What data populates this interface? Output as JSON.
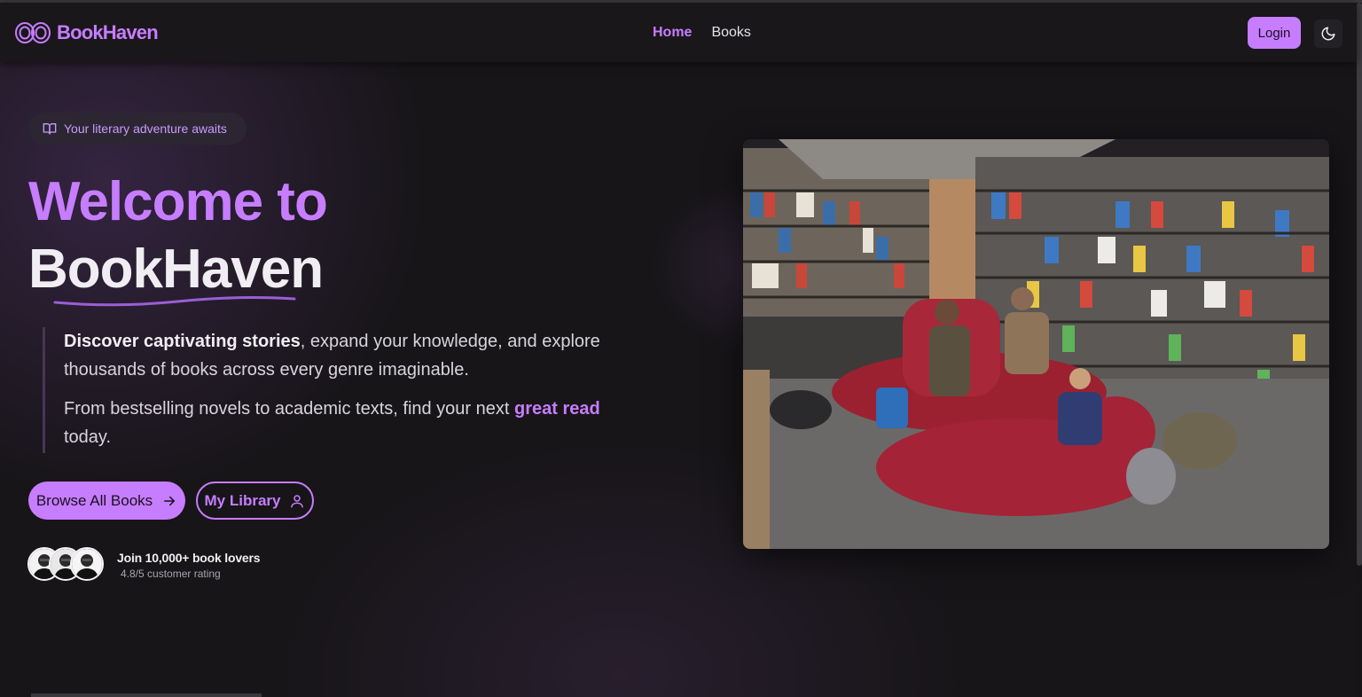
{
  "brand": {
    "name": "BookHaven",
    "accent": "#c77dff"
  },
  "nav": {
    "home": "Home",
    "books": "Books"
  },
  "header": {
    "login_label": "Login",
    "theme_icon": "moon-icon"
  },
  "hero": {
    "badge": "Your literary adventure awaits",
    "badge_icon": "open-book-icon",
    "title_line1": "Welcome to",
    "title_line2": "BookHaven",
    "p1_strong": "Discover captivating stories",
    "p1_rest": ", expand your knowledge, and explore thousands of books across every genre imaginable.",
    "p2_before": "From bestselling novels to academic texts, find your next ",
    "p2_accent": "great read",
    "p2_after": " today.",
    "primary_button": "Browse All Books",
    "primary_icon": "arrow-right-icon",
    "secondary_button": "My Library",
    "secondary_icon": "user-icon"
  },
  "social_proof": {
    "title": "Join 10,000+ book lovers",
    "subtitle": "4.8/5 customer rating"
  },
  "colors": {
    "background": "#171518",
    "navbar": "#19171a",
    "accent": "#c77dff",
    "text": "#f0eef2"
  }
}
